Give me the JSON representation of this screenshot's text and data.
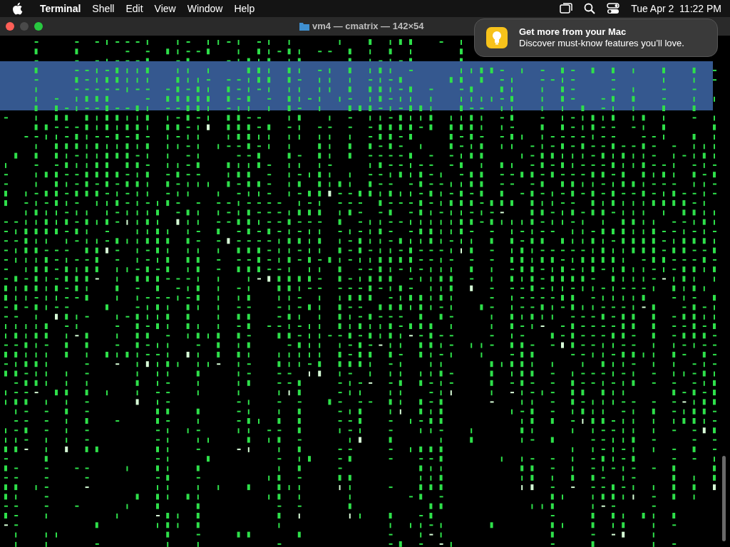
{
  "menu_bar": {
    "app_name": "Terminal",
    "items": [
      "Shell",
      "Edit",
      "View",
      "Window",
      "Help"
    ],
    "clock": "Tue Apr 2  11:22 PM"
  },
  "window": {
    "title": "vm4 — cmatrix — 142×54"
  },
  "notification": {
    "title": "Get more from your Mac",
    "body": "Discover must-know features you’ll love."
  }
}
